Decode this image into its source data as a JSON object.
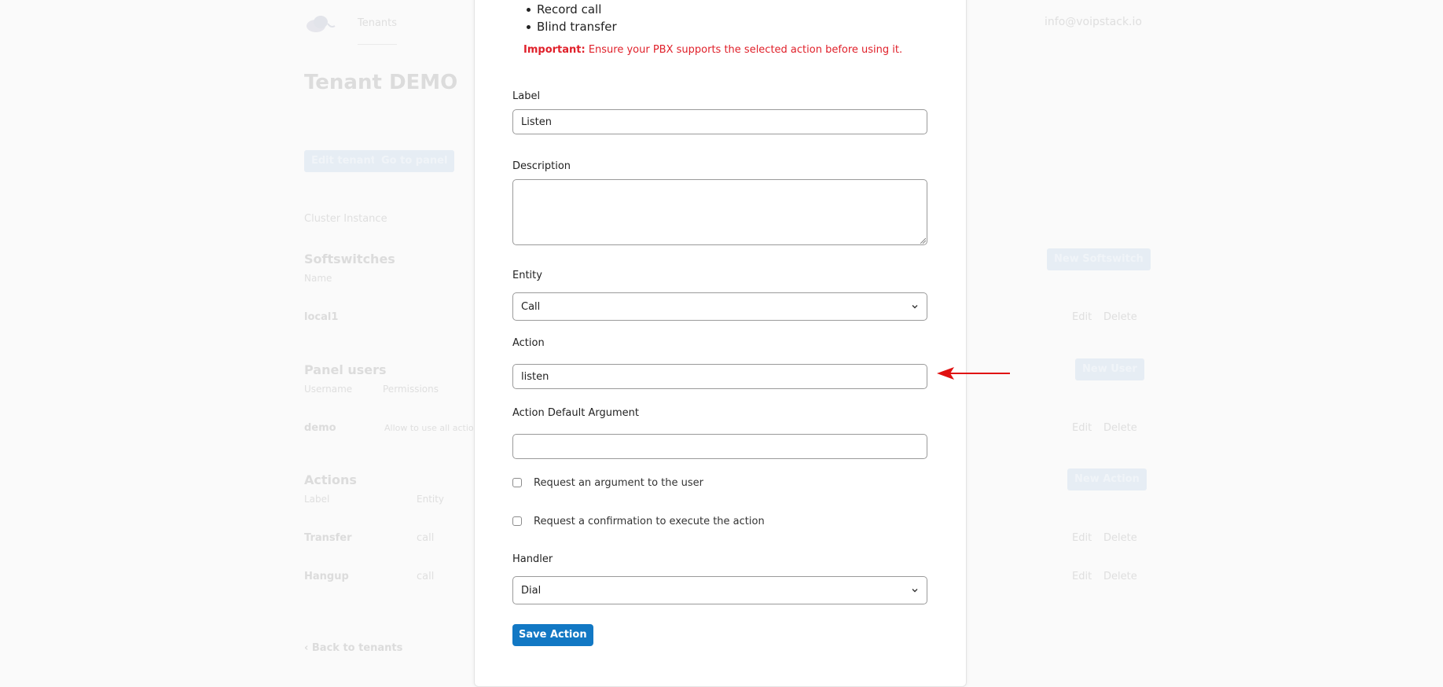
{
  "background": {
    "nav_tenants": "Tenants",
    "user_email": "info@voipstack.io",
    "page_title": "Tenant DEMO",
    "edit_tenant_label": "Edit tenant",
    "go_to_panel_label": "Go to panel",
    "cluster_instance": "Cluster Instance",
    "softswitches": {
      "title": "Softswitches",
      "col_name": "Name",
      "new_label": "New Softswitch",
      "rows": [
        {
          "name": "local1",
          "edit": "Edit",
          "delete": "Delete"
        }
      ]
    },
    "panel_users": {
      "title": "Panel users",
      "col_username": "Username",
      "col_permissions": "Permissions",
      "new_label": "New User",
      "rows": [
        {
          "username": "demo",
          "permissions": "Allow to use all actions",
          "edit": "Edit",
          "delete": "Delete"
        }
      ]
    },
    "actions": {
      "title": "Actions",
      "col_label": "Label",
      "col_entity": "Entity",
      "new_label": "New Action",
      "rows": [
        {
          "label": "Transfer",
          "entity": "call",
          "edit": "Edit",
          "delete": "Delete"
        },
        {
          "label": "Hangup",
          "entity": "call",
          "edit": "Edit",
          "delete": "Delete"
        }
      ]
    },
    "back_link": "Back to tenants"
  },
  "modal": {
    "bullets": [
      "Record call",
      "Blind transfer"
    ],
    "important_prefix": "Important:",
    "important_text": " Ensure your PBX supports the selected action before using it.",
    "label_field": {
      "label": "Label",
      "value": "Listen"
    },
    "description_field": {
      "label": "Description",
      "value": ""
    },
    "entity_field": {
      "label": "Entity",
      "value": "Call"
    },
    "action_field": {
      "label": "Action",
      "value": "listen"
    },
    "default_arg_field": {
      "label": "Action Default Argument",
      "value": ""
    },
    "checkbox_argument": {
      "label": "Request an argument to the user",
      "checked": false
    },
    "checkbox_confirmation": {
      "label": "Request a confirmation to execute the action",
      "checked": false
    },
    "handler_field": {
      "label": "Handler",
      "value": "Dial"
    },
    "save_label": "Save Action"
  },
  "colors": {
    "primary": "#1278c4",
    "important": "#e0202a",
    "annotation_arrow": "#e01010"
  }
}
